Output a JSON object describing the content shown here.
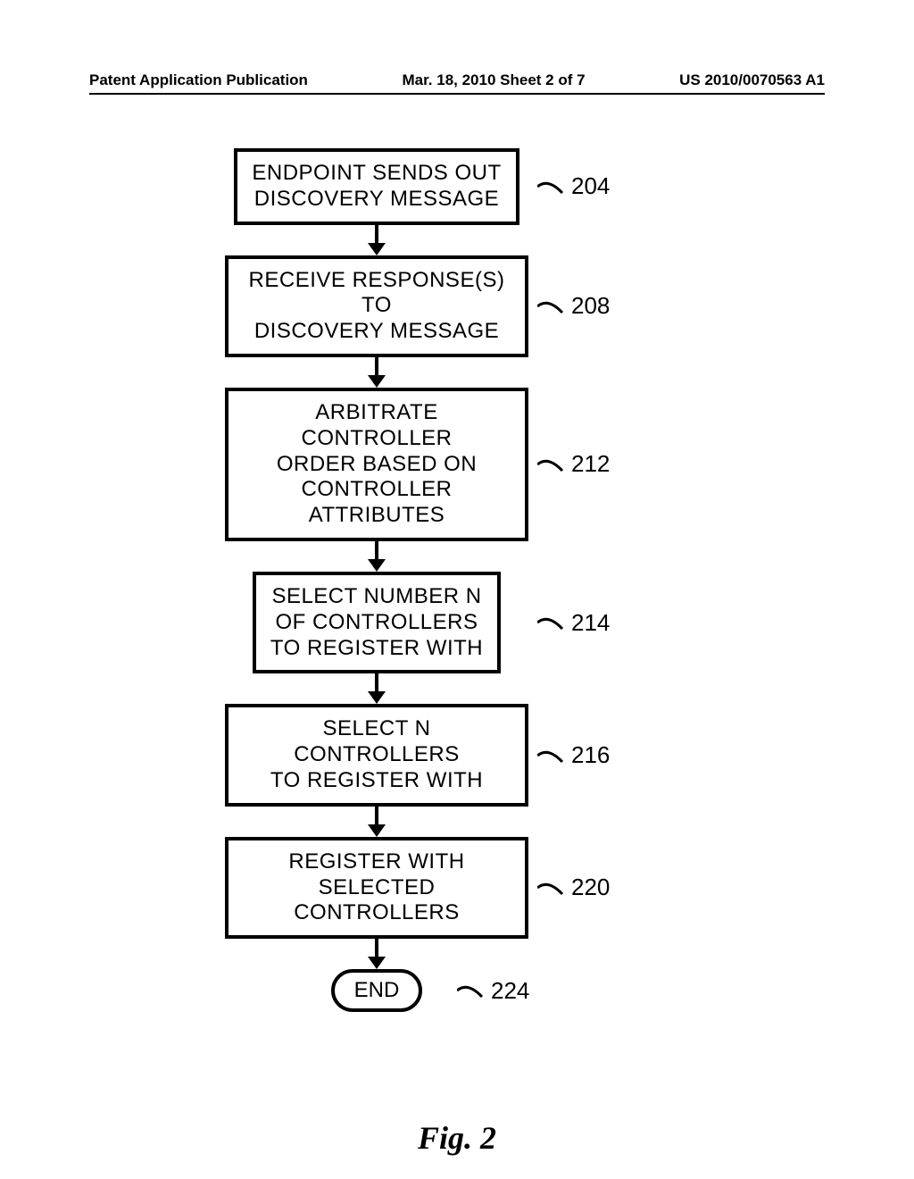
{
  "header": {
    "left": "Patent Application Publication",
    "center": "Mar. 18, 2010  Sheet 2 of 7",
    "right": "US 2010/0070563 A1"
  },
  "steps": [
    {
      "text_line1": "ENDPOINT SENDS OUT",
      "text_line2": "DISCOVERY MESSAGE",
      "text_line3": "",
      "ref": "204"
    },
    {
      "text_line1": "RECEIVE RESPONSE(S) TO",
      "text_line2": "DISCOVERY MESSAGE",
      "text_line3": "",
      "ref": "208"
    },
    {
      "text_line1": "ARBITRATE CONTROLLER",
      "text_line2": "ORDER BASED ON",
      "text_line3": "CONTROLLER ATTRIBUTES",
      "ref": "212"
    },
    {
      "text_line1": "SELECT NUMBER N",
      "text_line2": "OF CONTROLLERS",
      "text_line3": "TO REGISTER WITH",
      "ref": "214"
    },
    {
      "text_line1": "SELECT N CONTROLLERS",
      "text_line2": "TO REGISTER WITH",
      "text_line3": "",
      "ref": "216"
    },
    {
      "text_line1": "REGISTER WITH",
      "text_line2": "SELECTED CONTROLLERS",
      "text_line3": "",
      "ref": "220"
    }
  ],
  "terminator": {
    "label": "END",
    "ref": "224"
  },
  "figure": {
    "caption": "Fig. 2"
  }
}
